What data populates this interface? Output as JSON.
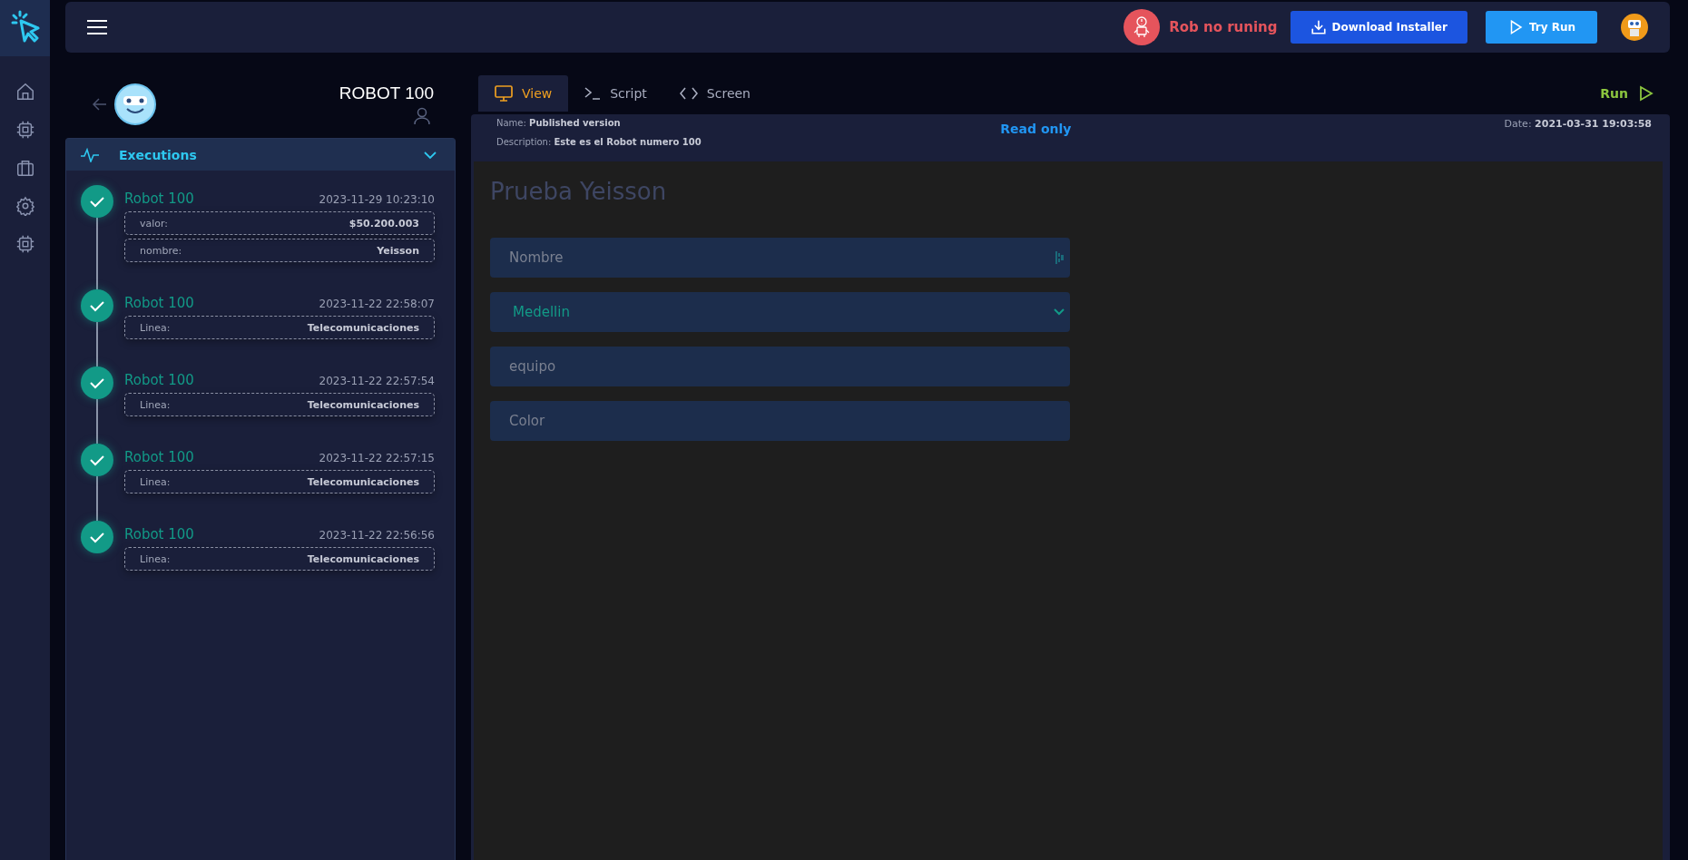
{
  "top_bar": {
    "status": "Rob no runing",
    "buttons": [
      {
        "label": "Download Installer",
        "kind": "download"
      },
      {
        "label": "Try Run",
        "kind": "play"
      }
    ]
  },
  "robot": {
    "title": "ROBOT 100"
  },
  "executions": {
    "title": "Executions",
    "expanded": true,
    "items": [
      {
        "name": "Robot 100",
        "time": "2023-11-29 10:23:10",
        "fields": [
          {
            "label": "valor:",
            "value": "$50.200.003"
          },
          {
            "label": "nombre:",
            "value": "Yeisson"
          }
        ]
      },
      {
        "name": "Robot 100",
        "time": "2023-11-22 22:58:07",
        "fields": [
          {
            "label": "Linea:",
            "value": "Telecomunicaciones"
          }
        ]
      },
      {
        "name": "Robot 100",
        "time": "2023-11-22 22:57:54",
        "fields": [
          {
            "label": "Linea:",
            "value": "Telecomunicaciones"
          }
        ]
      },
      {
        "name": "Robot 100",
        "time": "2023-11-22 22:57:15",
        "fields": [
          {
            "label": "Linea:",
            "value": "Telecomunicaciones"
          }
        ]
      },
      {
        "name": "Robot 100",
        "time": "2023-11-22 22:56:56",
        "fields": [
          {
            "label": "Linea:",
            "value": "Telecomunicaciones"
          }
        ]
      }
    ]
  },
  "tabs": [
    {
      "label": "View",
      "kind": "monitor",
      "selected": true
    },
    {
      "label": "Script",
      "kind": "terminal",
      "selected": false
    },
    {
      "label": "Screen",
      "kind": "code",
      "selected": false
    }
  ],
  "run_button": "Run",
  "info": {
    "name_label": "Name:",
    "name": "Published version",
    "description_label": "Description:",
    "description": "Este es el Robot numero 100",
    "mode": "Read only",
    "date_label": "Date:",
    "date": "2021-03-31 19:03:58"
  },
  "form": {
    "title": "Prueba Yeisson",
    "fields": [
      {
        "kind": "text",
        "placeholder": "Nombre"
      },
      {
        "kind": "select",
        "value": "Medellin"
      },
      {
        "kind": "text",
        "placeholder": "equipo"
      },
      {
        "kind": "text",
        "placeholder": "Color"
      }
    ]
  }
}
